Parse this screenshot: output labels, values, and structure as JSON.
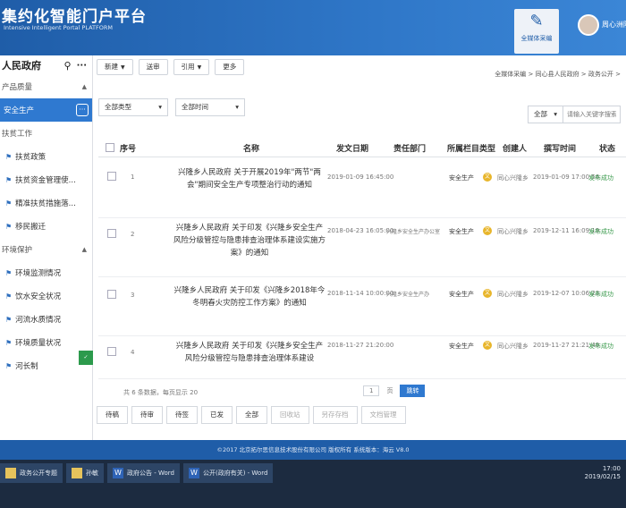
{
  "header": {
    "title": "集约化智能门户平台",
    "subtitle": "Intensive Intelligent Portal PLATFORM",
    "app_label": "全媒体采编",
    "user_name": "周心洲隆乡"
  },
  "sidebar": {
    "title": "人民政府",
    "items": [
      {
        "label": "产品质量",
        "kind": "group"
      },
      {
        "label": "安全生产",
        "kind": "active"
      },
      {
        "label": "扶贫工作",
        "kind": "group"
      },
      {
        "label": "扶贫政策",
        "kind": "sub"
      },
      {
        "label": "扶贫资金管理使...",
        "kind": "sub"
      },
      {
        "label": "精准扶贫措施落...",
        "kind": "sub"
      },
      {
        "label": "移民搬迁",
        "kind": "sub"
      },
      {
        "label": "环境保护",
        "kind": "group"
      },
      {
        "label": "环境监测情况",
        "kind": "sub"
      },
      {
        "label": "饮水安全状况",
        "kind": "sub"
      },
      {
        "label": "河流水质情况",
        "kind": "sub"
      },
      {
        "label": "环境质量状况",
        "kind": "sub"
      },
      {
        "label": "河长制",
        "kind": "sub"
      }
    ]
  },
  "toolbar": {
    "new_label": "新建",
    "send_label": "送审",
    "ref_label": "引用",
    "more_label": "更多"
  },
  "breadcrumb": "全媒体采编 > 同心县人民政府 > 政务公开 >",
  "filters": {
    "type_label": "全部类型",
    "time_label": "全部时间",
    "scope_label": "全部",
    "search_placeholder": "请输入关键字搜索"
  },
  "table": {
    "headers": {
      "seq": "序号",
      "name": "名称",
      "publish": "发文日期",
      "dept": "责任部门",
      "column": "所属栏目",
      "type": "类型",
      "creator": "创建人",
      "write_time": "撰写时间",
      "status": "状态"
    },
    "rows": [
      {
        "seq": "1",
        "name": "兴隆乡人民政府 关于开展2019年\"两节\"两会\"期间安全生产专项整治行动的通知",
        "publish": "2019-01-09 16:45:00",
        "dept": "",
        "column": "安全生产",
        "type": "文",
        "creator": "同心兴隆乡",
        "write_time": "2019-01-09 17:00:56",
        "status": "发布成功"
      },
      {
        "seq": "2",
        "name": "兴隆乡人民政府 关于印发《兴隆乡安全生产风险分级管控与隐患排查治理体系建设实施方案》的通知",
        "publish": "2018-04-23 16:05:00",
        "dept": "兴隆乡安全生产办公室",
        "column": "安全生产",
        "type": "文",
        "creator": "同心兴隆乡",
        "write_time": "2019-12-11 16:09:19",
        "status": "发布成功"
      },
      {
        "seq": "3",
        "name": "兴隆乡人民政府 关于印发《兴隆乡2018年今冬明春火灾防控工作方案》的通知",
        "publish": "2018-11-14 10:00:00",
        "dept": "兴隆乡安全生产办",
        "column": "安全生产",
        "type": "文",
        "creator": "同心兴隆乡",
        "write_time": "2019-12-07 10:06:23",
        "status": "发布成功"
      },
      {
        "seq": "4",
        "name": "兴隆乡人民政府 关于印发《兴隆乡安全生产风险分级管控与隐患排查治理体系建设",
        "publish": "2018-11-27 21:20:00",
        "dept": "",
        "column": "安全生产",
        "type": "文",
        "creator": "同心兴隆乡",
        "write_time": "2019-11-27 21:21:49",
        "status": "发布成功"
      }
    ]
  },
  "pager": {
    "summary": "共 6 条数据，每页显示 20",
    "page_num": "1",
    "page_label": "页",
    "jump_label": "跳转"
  },
  "bottom_tabs": [
    "待稿",
    "待审",
    "待签",
    "已发",
    "全部",
    "回收站",
    "另存存档",
    "文档管理"
  ],
  "footer": "©2017 北京拓尔思信息技术股份有限公司 版权所有 系统版本：海云 V8.0",
  "taskbar": {
    "tasks": [
      "政务公开专题",
      "孙敏",
      "政府公告 - Word",
      "公开(政府有关) - Word"
    ],
    "time": "17:00",
    "date": "2019/02/15"
  }
}
